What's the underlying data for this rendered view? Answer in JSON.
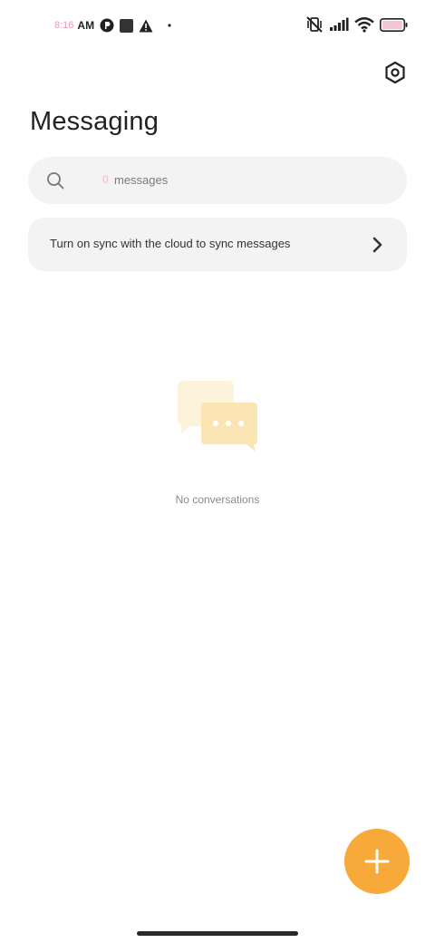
{
  "status_bar": {
    "time": "8:16",
    "ampm": "AM",
    "icons_left": [
      "clock-icon",
      "p-app-icon",
      "square-app-icon",
      "warning-icon",
      "dot-icon"
    ],
    "icons_right": [
      "muted-vibrate-icon",
      "signal-icon",
      "wifi-icon",
      "battery-icon"
    ]
  },
  "header": {
    "title": "Messaging",
    "settings_icon": "settings-hexagon-icon"
  },
  "search": {
    "count": "0",
    "placeholder": "messages"
  },
  "sync_banner": {
    "text": "Turn on sync with the cloud to sync messages"
  },
  "empty_state": {
    "text": "No conversations"
  },
  "fab": {
    "icon": "plus-icon"
  },
  "colors": {
    "accent": "#f7a93a",
    "surface": "#f3f3f3",
    "illustration_back": "#fdf3dc",
    "illustration_front": "#fbe5b4"
  }
}
